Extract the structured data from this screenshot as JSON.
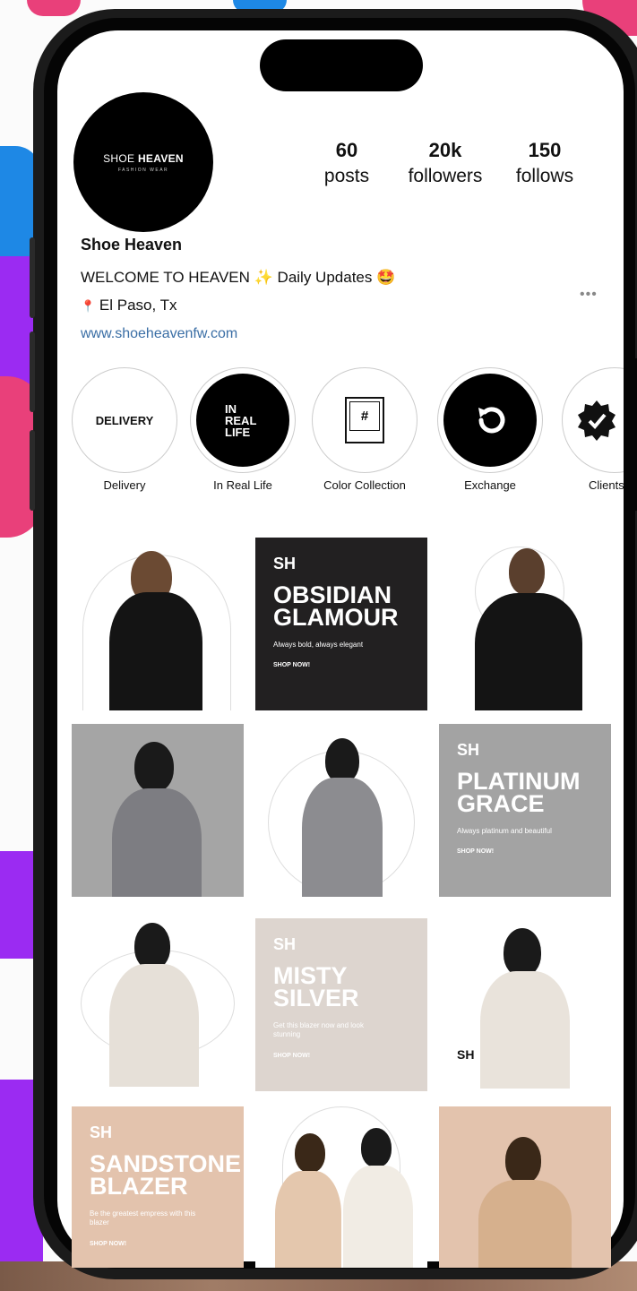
{
  "profile": {
    "avatar_brand_light": "SHOE",
    "avatar_brand_bold": "HEAVEN",
    "avatar_subtitle": "FASHION WEAR",
    "name": "Shoe Heaven",
    "bio": "WELCOME TO HEAVEN ✨ Daily Updates 🤩",
    "location_icon": "📍",
    "location": "El Paso, Tx",
    "website": "www.shoeheavenfw.com",
    "more_icon": "•••"
  },
  "stats": [
    {
      "value": "60",
      "label": "posts"
    },
    {
      "value": "20k",
      "label": "followers"
    },
    {
      "value": "150",
      "label": "follows"
    }
  ],
  "highlights": [
    {
      "label": "Delivery",
      "cover_text": "DELIVERY",
      "icon": "delivery-text"
    },
    {
      "label": "In Real Life",
      "cover_text": "IN REAL LIFE",
      "icon": "in-real-life-text"
    },
    {
      "label": "Color Collection",
      "cover_text": "#",
      "icon": "polaroid-icon"
    },
    {
      "label": "Exchange",
      "cover_text": "",
      "icon": "exchange-icon"
    },
    {
      "label": "Clients",
      "cover_text": "",
      "icon": "verified-badge-icon"
    }
  ],
  "posts": [
    {
      "logo": "SH",
      "title_l1": "OBSIDIAN",
      "title_l2": "GLAMOUR",
      "tagline": "Always bold, always elegant",
      "cta": "SHOP NOW!"
    },
    {
      "logo": "SH",
      "title_l1": "PLATINUM",
      "title_l2": "GRACE",
      "tagline": "Always platinum and beautiful",
      "cta": "SHOP NOW!"
    },
    {
      "logo": "SH",
      "title_l1": "MISTY",
      "title_l2": "SILVER",
      "tagline": "Get this blazer now and look stunning",
      "cta": "SHOP NOW!"
    },
    {
      "logo": "SH",
      "title_l1": "SANDSTONE",
      "title_l2": "BLAZER",
      "tagline": "Be the greatest empress with this blazer",
      "cta": "SHOP NOW!"
    }
  ],
  "watermark_logo": "SH",
  "colors": {
    "obsidian": "#222021",
    "platinum": "#a3a3a3",
    "misty": "#ddd5cf",
    "sandstone": "#e3c3ad",
    "link": "#3a6ea5"
  }
}
